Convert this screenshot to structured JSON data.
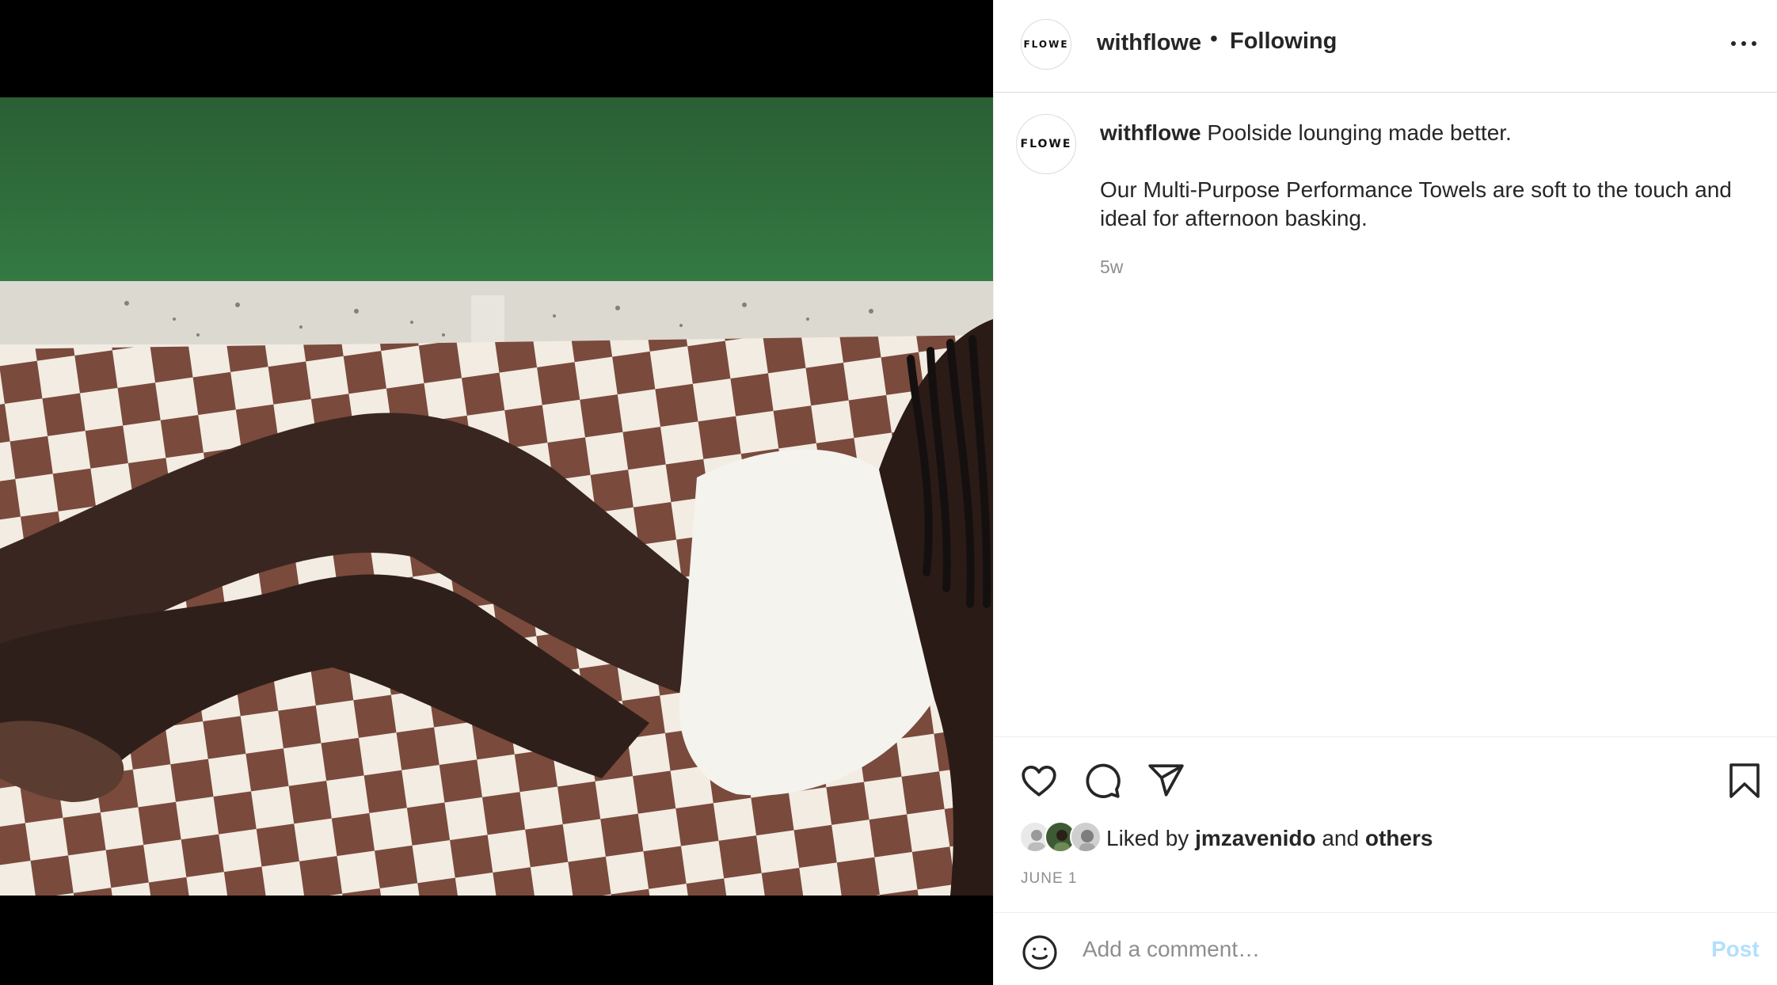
{
  "post": {
    "username": "withflowe",
    "avatar_text": "FLOWE",
    "separator": "•",
    "follow_status": "Following",
    "caption_text": "Poolside lounging made better.",
    "caption_body": "Our Multi-Purpose Performance Towels are soft to the touch and ideal for afternoon basking.",
    "time_ago": "5w",
    "date": "JUNE 1"
  },
  "likes": {
    "prefix": "Liked by",
    "user": "jmzavenido",
    "conjunction": "and",
    "others": "others"
  },
  "comment": {
    "placeholder": "Add a comment…",
    "post_label": "Post"
  },
  "icons": {
    "more": "more-options-icon",
    "like": "heart-icon",
    "comment": "comment-bubble-icon",
    "share": "paper-plane-icon",
    "save": "bookmark-icon",
    "emoji": "smiley-icon"
  },
  "colors": {
    "pool_green": "#2f6d3c",
    "check_brown": "#7a4a3c",
    "check_cream": "#f2ece2",
    "link_blue_disabled": "#b2dffc",
    "secondary_text": "#8e8e8e"
  }
}
